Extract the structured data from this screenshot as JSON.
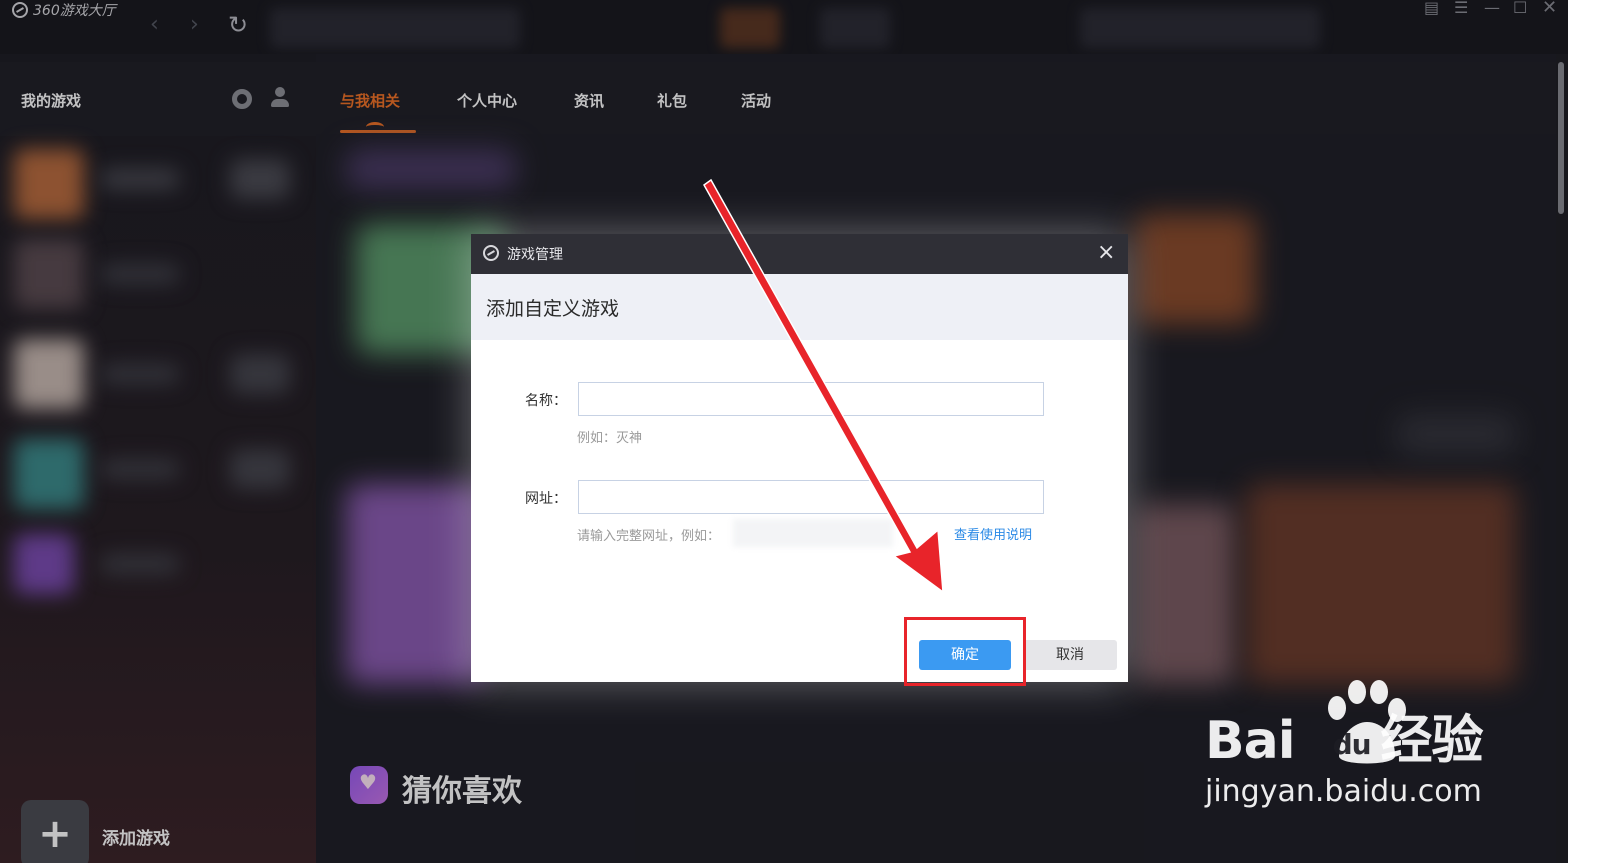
{
  "app": {
    "title": "360游戏大厅"
  },
  "sidebar": {
    "title": "我的游戏",
    "add_game_label": "添加游戏",
    "add_game_symbol": "+"
  },
  "tabs": [
    {
      "label": "与我相关",
      "active": true
    },
    {
      "label": "个人中心",
      "active": false
    },
    {
      "label": "资讯",
      "active": false
    },
    {
      "label": "礼包",
      "active": false
    },
    {
      "label": "活动",
      "active": false
    }
  ],
  "section": {
    "guess_title": "猜你喜欢"
  },
  "dialog": {
    "title": "游戏管理",
    "heading": "添加自定义游戏",
    "close_symbol": "×",
    "name": {
      "label": "名称：",
      "value": "",
      "hint": "例如：灭神"
    },
    "url": {
      "label": "网址：",
      "value": "",
      "hint": "请输入完整网址，例如："
    },
    "help_link": "查看使用说明",
    "confirm_label": "确定",
    "cancel_label": "取消"
  },
  "watermark": {
    "brand": "Bai",
    "brand_suffix": "du",
    "product": "经验",
    "url": "jingyan.baidu.com"
  },
  "colors": {
    "accent": "#f07124",
    "confirm": "#3b9af2",
    "annotation": "#e8242a",
    "link": "#2b8ae6"
  }
}
